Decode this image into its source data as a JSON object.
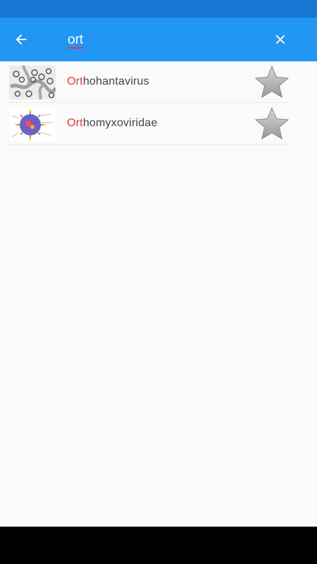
{
  "search": {
    "query": "ort"
  },
  "icons": {
    "back": "arrow-back-icon",
    "close": "close-icon",
    "favorite": "star-icon"
  },
  "colors": {
    "status_bar": "#1976d2",
    "app_bar": "#2196f3",
    "highlight": "#e53935",
    "background": "#fafafa"
  },
  "results": [
    {
      "match": "Ort",
      "rest": "hohantavirus",
      "favorite": false
    },
    {
      "match": "Ort",
      "rest": "homyxoviridae",
      "favorite": false
    }
  ]
}
